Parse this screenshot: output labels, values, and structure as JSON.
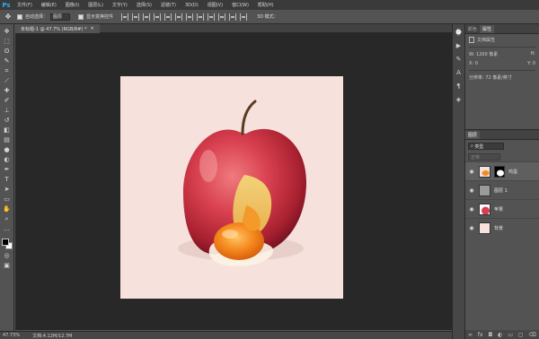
{
  "app": {
    "logo": "Ps"
  },
  "menu": [
    "文件(F)",
    "编辑(E)",
    "图像(I)",
    "图层(L)",
    "文字(Y)",
    "选择(S)",
    "滤镜(T)",
    "3D(D)",
    "视图(V)",
    "窗口(W)",
    "帮助(H)"
  ],
  "options": {
    "auto_select_label": "自动选择：",
    "auto_select_value": "图层",
    "show_transform_label": "显示变换控件",
    "mode_3d_label": "3D 模式："
  },
  "document": {
    "tab_title": "未标题-1 @ 47.7% (RGB/8#) *",
    "close_glyph": "×"
  },
  "status": {
    "zoom": "47.73%",
    "doc_size": "文档:4.12M/12.7M"
  },
  "panels": {
    "top_tabs": [
      "颜色",
      "属性"
    ],
    "props_title": "文档属性",
    "width_label": "W:",
    "width_value": "1200 像素",
    "height_label": "H:",
    "height_value": "",
    "x_label": "X:",
    "x_value": "0",
    "y_label": "Y:",
    "y_value": "0",
    "res_label": "分辨率: 72 像素/英寸",
    "layers_tab": "图层",
    "kind_value": "类型",
    "blend_value": "正常",
    "layers": [
      {
        "name": "鸡蛋",
        "selected": true,
        "has_mask": true,
        "thumb": "egg"
      },
      {
        "name": "图层 1",
        "selected": false,
        "has_mask": false,
        "thumb": "gray"
      },
      {
        "name": "苹果",
        "selected": false,
        "has_mask": false,
        "thumb": "apple"
      },
      {
        "name": "背景",
        "selected": false,
        "has_mask": false,
        "thumb": "pink"
      }
    ]
  },
  "colors": {
    "brand": "#31a8ff",
    "canvas_bg": "#282828",
    "artboard_bg": "#f6e1dc"
  }
}
